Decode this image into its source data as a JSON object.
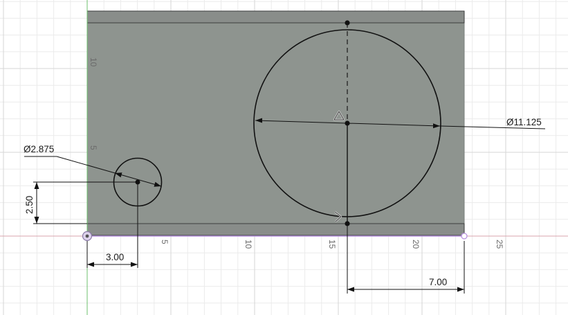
{
  "viewport": {
    "background": "#ffffff",
    "grid_minor_color": "#ebebeb",
    "grid_major_color": "#d6d6d6",
    "x_axis_color": "#d9a3ad",
    "y_axis_color": "#6cc06c"
  },
  "body": {
    "face_color": "#8e948f",
    "border_color": "#7b807c"
  },
  "axis_labels": {
    "x": [
      "5",
      "10",
      "15",
      "20",
      "25"
    ],
    "y": [
      "5",
      "10"
    ]
  },
  "dimensions": {
    "small_diameter": "Ø2.875",
    "small_height": "2.50",
    "small_offset_x": "3.00",
    "large_diameter": "Ø11.125",
    "large_offset_x": "7.00"
  },
  "icons": {
    "origin": "origin-point-icon",
    "endpoint": "sketch-endpoint-icon",
    "horizontal_constraint": "horizontal-constraint-icon",
    "coincident_constraint": "coincident-constraint-icon"
  }
}
